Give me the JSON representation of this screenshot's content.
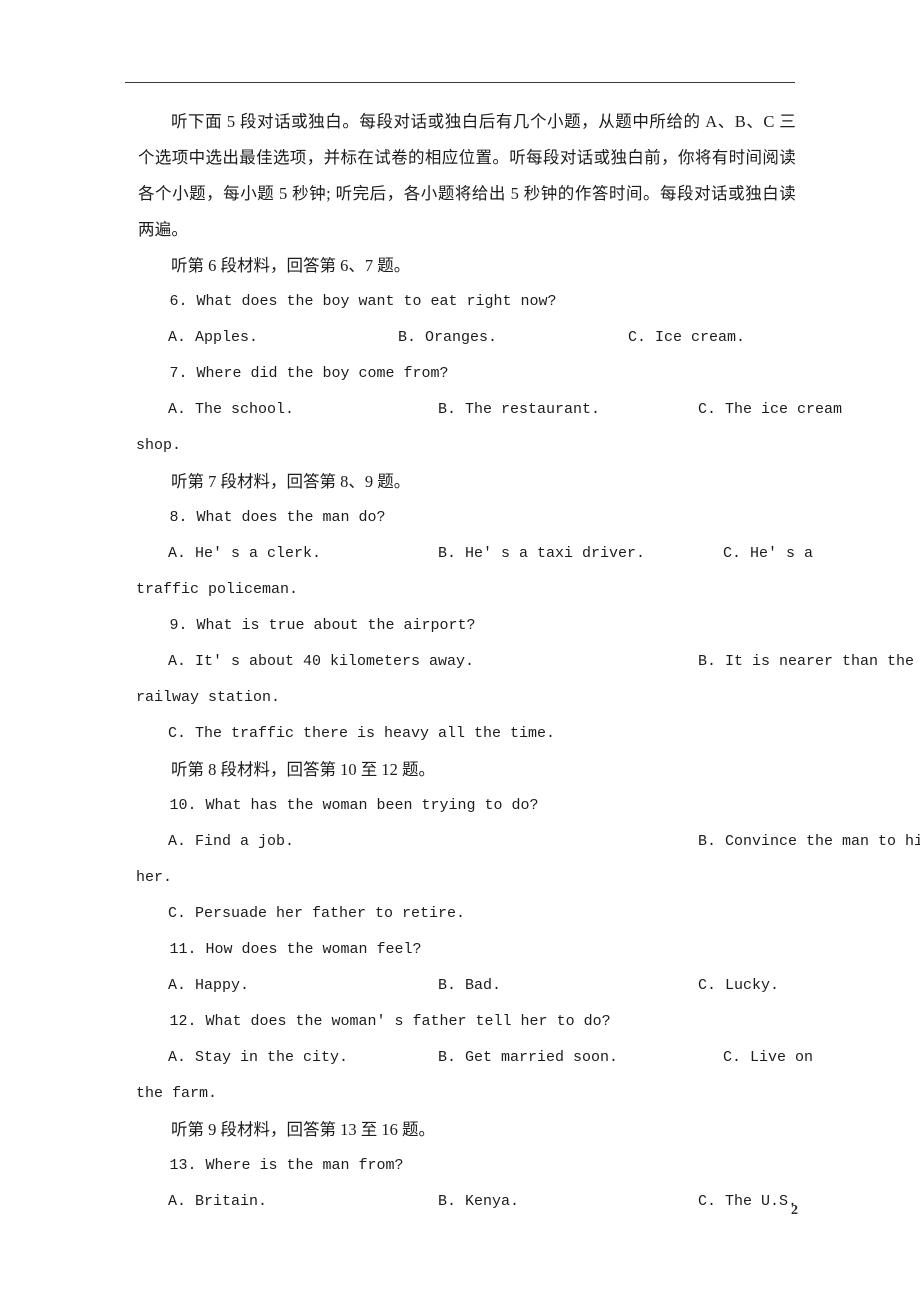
{
  "document": {
    "page_number": "2",
    "header_rule": true
  },
  "intro": {
    "paragraph": "听下面 5 段对话或独白。每段对话或独白后有几个小题，从题中所给的 A、B、C 三个选项中选出最佳选项，并标在试卷的相应位置。听每段对话或独白前，你将有时间阅读各个小题，每小题 5 秒钟; 听完后，各小题将给出 5 秒钟的作答时间。每段对话或独白读两遍。"
  },
  "sections": [
    {
      "heading": "听第 6 段材料，回答第 6、7 题。",
      "questions": [
        {
          "number": "6.",
          "text": "6. What does the boy want to eat right now?",
          "options": {
            "a": "A. Apples.",
            "b": "B. Oranges.",
            "c": "C. Ice cream."
          },
          "wrap": ""
        },
        {
          "number": "7.",
          "text": "7. Where did the boy come from?",
          "options": {
            "a": "A. The school.",
            "b": "B. The restaurant.",
            "c": "C. The ice cream"
          },
          "wrap": "shop."
        }
      ]
    },
    {
      "heading": "听第 7 段材料，回答第 8、9 题。",
      "questions": [
        {
          "number": "8.",
          "text": "8. What does the man do?",
          "options": {
            "a": "A. He' s a clerk.",
            "b": "B. He' s a taxi driver.",
            "c": "C. He' s a"
          },
          "wrap": "traffic policeman."
        },
        {
          "number": "9.",
          "text": "9. What is true about the airport?",
          "options": {
            "a": "A. It' s about 40 kilometers away.",
            "b": "B. It is nearer than the",
            "c": "C. The traffic there is heavy all the time."
          },
          "wrap": "railway station."
        }
      ]
    },
    {
      "heading": "听第 8 段材料，回答第 10 至 12 题。",
      "questions": [
        {
          "number": "10.",
          "text": "10. What has the woman been trying to do?",
          "options": {
            "a": "A. Find a job.",
            "b": "B. Convince the man to hire",
            "c": "C. Persuade her father to retire."
          },
          "wrap": "her."
        },
        {
          "number": "11.",
          "text": "11. How does the woman feel?",
          "options": {
            "a": "A. Happy.",
            "b": "B. Bad.",
            "c": "C. Lucky."
          },
          "wrap": ""
        },
        {
          "number": "12.",
          "text": "12. What does the woman' s father tell her to do?",
          "options": {
            "a": "A. Stay in the city.",
            "b": "B. Get married soon.",
            "c": "C. Live on"
          },
          "wrap": "the farm."
        }
      ]
    },
    {
      "heading": "听第 9 段材料，回答第 13 至 16 题。",
      "questions": [
        {
          "number": "13.",
          "text": "13. Where is the man from?",
          "options": {
            "a": "A. Britain.",
            "b": "B. Kenya.",
            "c": "C. The U.S."
          },
          "wrap": ""
        }
      ]
    }
  ]
}
